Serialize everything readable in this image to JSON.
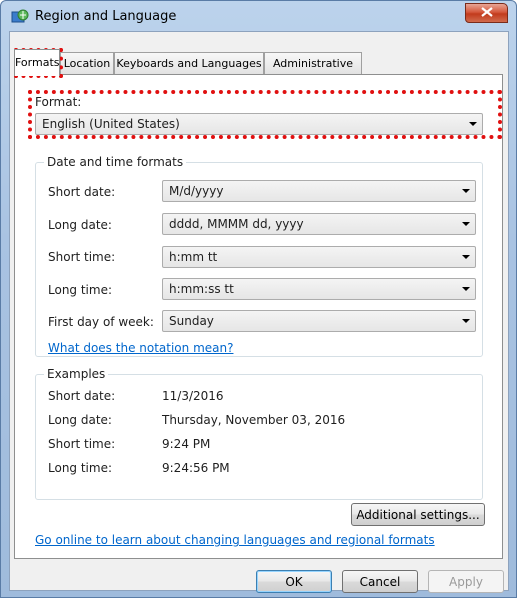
{
  "window": {
    "title": "Region and Language"
  },
  "tabs": [
    "Formats",
    "Location",
    "Keyboards and Languages",
    "Administrative"
  ],
  "formats": {
    "label": "Format:",
    "value": "English (United States)"
  },
  "datetime": {
    "group_title": "Date and time formats",
    "short_date_label": "Short date:",
    "short_date_value": "M/d/yyyy",
    "long_date_label": "Long date:",
    "long_date_value": "dddd, MMMM dd, yyyy",
    "short_time_label": "Short time:",
    "short_time_value": "h:mm tt",
    "long_time_label": "Long time:",
    "long_time_value": "h:mm:ss tt",
    "first_day_label": "First day of week:",
    "first_day_value": "Sunday",
    "notation_link": "What does the notation mean?"
  },
  "examples": {
    "group_title": "Examples",
    "short_date_label": "Short date:",
    "short_date_value": "11/3/2016",
    "long_date_label": "Long date:",
    "long_date_value": "Thursday, November 03, 2016",
    "short_time_label": "Short time:",
    "short_time_value": "9:24 PM",
    "long_time_label": "Long time:",
    "long_time_value": "9:24:56 PM"
  },
  "additional_settings": "Additional settings...",
  "online_link": "Go online to learn about changing languages and regional formats",
  "buttons": {
    "ok": "OK",
    "cancel": "Cancel",
    "apply": "Apply"
  },
  "colors": {
    "highlight": "#e01010",
    "link": "#0066cc",
    "titlebar": "#a9c3e2"
  }
}
